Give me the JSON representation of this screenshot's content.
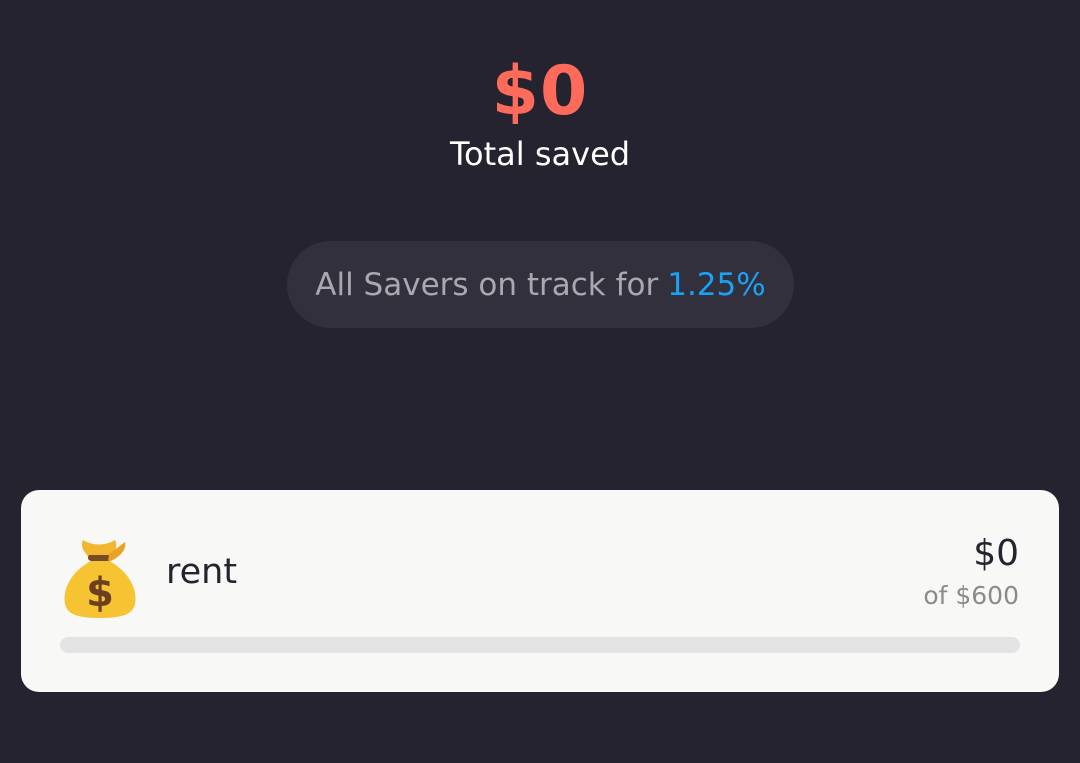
{
  "summary": {
    "total_amount": "$0",
    "total_label": "Total saved"
  },
  "rate_banner": {
    "text": "All Savers on track for",
    "rate": "1.25%"
  },
  "savers": [
    {
      "icon": "money-bag-icon",
      "name": "rent",
      "amount": "$0",
      "goal_text": "of $600",
      "progress": 0
    }
  ],
  "colors": {
    "background": "#24232f",
    "accent_total": "#ff6b5b",
    "accent_rate": "#1aa2f5",
    "card": "#f8f8f6"
  }
}
